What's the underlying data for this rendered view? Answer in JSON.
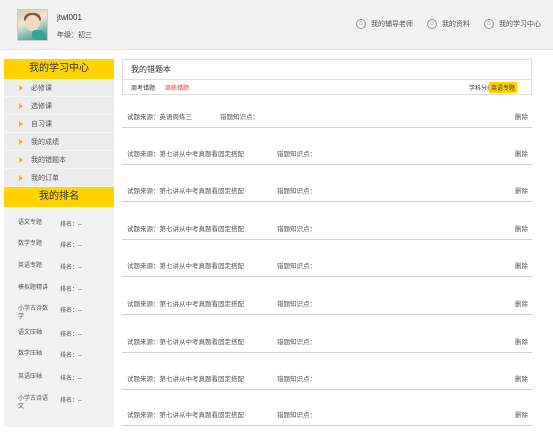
{
  "user": {
    "username": "jtwl001",
    "grade": "年级：初三"
  },
  "top_links": [
    {
      "icon": "user-circle-icon",
      "label": "我的辅导老师"
    },
    {
      "icon": "profile-circle-icon",
      "label": "我的资料"
    },
    {
      "icon": "study-circle-icon",
      "label": "我的学习中心"
    }
  ],
  "sidebar": {
    "title": "我的学习中心",
    "items": [
      "必修课",
      "选修课",
      "自习课",
      "我的成绩",
      "我的错题本",
      "我的订单"
    ],
    "rank_title": "我的排名",
    "ranks": [
      {
        "name": "语文专题",
        "value": "排名：--"
      },
      {
        "name": "数学专题",
        "value": "排名：--"
      },
      {
        "name": "英语专题",
        "value": "排名：--"
      },
      {
        "name": "模拟题精讲",
        "value": "排名：--"
      },
      {
        "name": "小学古诗数学",
        "value": "排名：--"
      },
      {
        "name": "语文压轴",
        "value": "排名：--"
      },
      {
        "name": "数学压轴",
        "value": "排名：--"
      },
      {
        "name": "英语压轴",
        "value": "排名：--"
      },
      {
        "name": "小学古诗语文",
        "value": "排名：--"
      }
    ]
  },
  "main": {
    "title": "我的错题本",
    "filter_left": "周考错题",
    "filter_red": "周练错题",
    "filter_right_label": "学科分类",
    "filter_tag": "英语专题",
    "questions": [
      {
        "source": "试题来源：英语周练三",
        "kp": "错题知识点：",
        "del": "删除"
      },
      {
        "source": "试题来源：第七讲从中考真题看固定搭配",
        "kp": "错题知识点：",
        "del": "删除"
      },
      {
        "source": "试题来源：第七讲从中考真题看固定搭配",
        "kp": "错题知识点：",
        "del": "删除"
      },
      {
        "source": "试题来源：第七讲从中考真题看固定搭配",
        "kp": "错题知识点：",
        "del": "删除"
      },
      {
        "source": "试题来源：第七讲从中考真题看固定搭配",
        "kp": "错题知识点：",
        "del": "删除"
      },
      {
        "source": "试题来源：第七讲从中考真题看固定搭配",
        "kp": "错题知识点：",
        "del": "删除"
      },
      {
        "source": "试题来源：第七讲从中考真题看固定搭配",
        "kp": "错题知识点：",
        "del": "删除"
      },
      {
        "source": "试题来源：第七讲从中考真题看固定搭配",
        "kp": "错题知识点：",
        "del": "删除"
      },
      {
        "source": "试题来源：第七讲从中考真题看固定搭配",
        "kp": "错题知识点：",
        "del": "删除"
      }
    ]
  },
  "colors": {
    "accent": "#ffd200",
    "highlight_red": "#ee3333"
  }
}
